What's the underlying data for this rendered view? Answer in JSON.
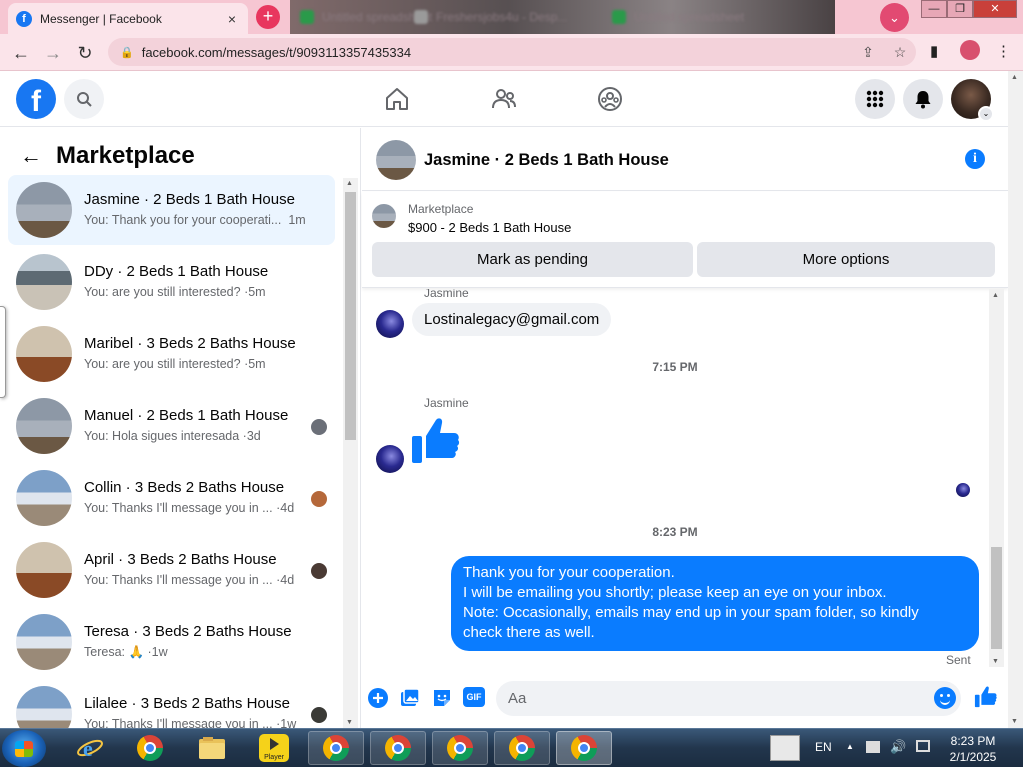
{
  "browser": {
    "tab_title": "Messenger | Facebook",
    "tab_favicon": "f",
    "close_tab": "×",
    "new_tab": "+",
    "ghost_tabs": [
      "Untitled spreadsheet",
      "Freshersjobs4u - Desp...",
      "Untitled spreadsheet"
    ],
    "url": "facebook.com/messages/t/9093113357435334",
    "icons": {
      "back": "←",
      "forward": "→",
      "reload": "↻",
      "lock": "🔒",
      "share": "⇪",
      "star": "☆",
      "sidepanel": "▮",
      "menu": "⋮",
      "profile_chevron": "⌄",
      "minimize": "—",
      "maximize": "❐",
      "close": "✕"
    }
  },
  "facebook": {
    "logo": "f",
    "brand_color": "#1877f2",
    "messenger_blue": "#0a7cff"
  },
  "left_panel": {
    "title": "Marketplace",
    "back_icon": "←",
    "conversations": [
      {
        "name": "Jasmine · 2 Beds 1 Bath House",
        "preview": "You: Thank you for your cooperati...",
        "time": "1m",
        "active": true
      },
      {
        "name": "DDy · 2 Beds 1 Bath House",
        "preview": "You: are you still interested?",
        "time": "5m"
      },
      {
        "name": "Maribel · 3 Beds 2 Baths House",
        "preview": "You: are you still interested?",
        "time": "5m"
      },
      {
        "name": "Manuel · 2 Beds 1 Bath House",
        "preview": "You: Hola sigues interesada",
        "time": "3d"
      },
      {
        "name": "Collin · 3 Beds 2 Baths House",
        "preview": "You: Thanks I'll message you in ...",
        "time": "4d"
      },
      {
        "name": "April · 3 Beds 2 Baths House",
        "preview": "You: Thanks I'll message you in ...",
        "time": "4d"
      },
      {
        "name": "Teresa · 3 Beds 2 Baths House",
        "preview": "Teresa: 🙏",
        "time": "1w"
      },
      {
        "name": "Lilalee · 3 Beds 2 Baths House",
        "preview": "You: Thanks I'll message you in ...",
        "time": "1w"
      }
    ]
  },
  "chat": {
    "title": "Jasmine · 2 Beds 1 Bath House",
    "info_icon": "i",
    "marketplace_label": "Marketplace",
    "listing": "$900 - 2 Beds 1 Bath House",
    "mark_pending": "Mark as pending",
    "more_options": "More options",
    "sender1": "Jasmine",
    "email_message": "Lostinalegacy@gmail.com",
    "time1": "7:15 PM",
    "sender2": "Jasmine",
    "time2": "8:23 PM",
    "outgoing_lines": [
      "Thank you for your cooperation.",
      "I will be emailing you shortly; please keep an eye on your inbox.",
      "Note: Occasionally, emails may end up in your spam folder, so kindly",
      "check there as well."
    ],
    "status": "Sent",
    "composer_placeholder": "Aa",
    "gif_label": "GIF"
  },
  "taskbar": {
    "language": "EN",
    "clock_time": "8:23 PM",
    "clock_date": "2/1/2025",
    "player_label": "Player",
    "tray_arrow": "▲"
  }
}
